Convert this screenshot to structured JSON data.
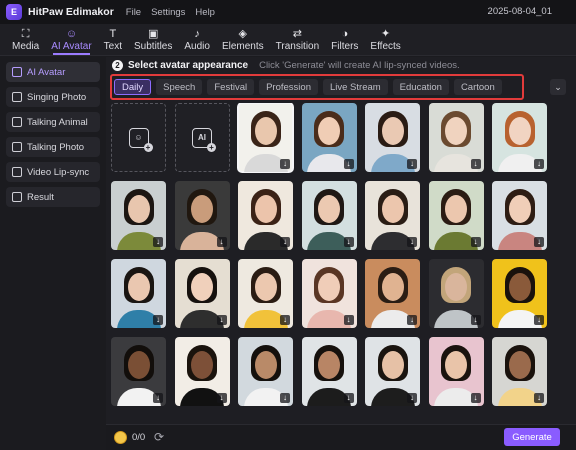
{
  "app": {
    "name": "HitPaw Edimakor",
    "logo_letter": "E",
    "project": "2025-08-04_01"
  },
  "menu": [
    "File",
    "Settings",
    "Help"
  ],
  "toolbar": [
    {
      "label": "Media",
      "icon": "media-icon",
      "glyph": "⛶"
    },
    {
      "label": "AI Avatar",
      "icon": "ai-avatar-icon",
      "glyph": "☺"
    },
    {
      "label": "Text",
      "icon": "text-icon",
      "glyph": "T"
    },
    {
      "label": "Subtitles",
      "icon": "subtitles-icon",
      "glyph": "▣"
    },
    {
      "label": "Audio",
      "icon": "audio-icon",
      "glyph": "♪"
    },
    {
      "label": "Elements",
      "icon": "elements-icon",
      "glyph": "◈"
    },
    {
      "label": "Transition",
      "icon": "transition-icon",
      "glyph": "⇄"
    },
    {
      "label": "Filters",
      "icon": "filters-icon",
      "glyph": "◑"
    },
    {
      "label": "Effects",
      "icon": "effects-icon",
      "glyph": "✦"
    }
  ],
  "sidebar": [
    {
      "label": "AI Avatar",
      "active": true
    },
    {
      "label": "Singing Photo"
    },
    {
      "label": "Talking Animal"
    },
    {
      "label": "Talking Photo"
    },
    {
      "label": "Video Lip-sync"
    },
    {
      "label": "Result"
    }
  ],
  "step": {
    "number": "2",
    "title": "Select avatar appearance",
    "hint": "Click 'Generate' will create AI lip-synced videos."
  },
  "tabs": [
    "Daily",
    "Speech",
    "Festival",
    "Profession",
    "Live Stream",
    "Education",
    "Cartoon"
  ],
  "active_tab": "Daily",
  "upload_tiles": [
    {
      "name": "upload-photo-tile",
      "glyph": "☺"
    },
    {
      "name": "ai-generate-tile",
      "glyph": "AI"
    }
  ],
  "download_glyph": "↓",
  "expand_glyph": "⌄",
  "avatars": [
    {
      "bg": "#f2f1ec",
      "skin": "#e9c7ad",
      "hair": "#3a2418",
      "cloth": "#d9d9d9",
      "selected": true
    },
    {
      "bg": "#7aa6c2",
      "skin": "#f0cdb5",
      "hair": "#4a2c1a",
      "cloth": "#e8e8ec"
    },
    {
      "bg": "#d8dde3",
      "skin": "#eac9b3",
      "hair": "#2a1c14",
      "cloth": "#7fa9c9"
    },
    {
      "bg": "#d9dcd6",
      "skin": "#f0d3bf",
      "hair": "#6b4a30",
      "cloth": "#e7e4de"
    },
    {
      "bg": "#d6e4e0",
      "skin": "#f1d4c2",
      "hair": "#b8622f",
      "cloth": "#f0f0f0"
    },
    {
      "bg": "#c9cfd0",
      "skin": "#e8c6ae",
      "hair": "#1c1612",
      "cloth": "#7c8a3a"
    },
    {
      "bg": "#3a3a3a",
      "skin": "#c99c7b",
      "hair": "#20170f",
      "cloth": "#d9b39a"
    },
    {
      "bg": "#efe8de",
      "skin": "#ecc4ab",
      "hair": "#3b2216",
      "cloth": "#2a2a2a"
    },
    {
      "bg": "#d3dfe0",
      "skin": "#ecc9b1",
      "hair": "#1f1814",
      "cloth": "#3d5e5a"
    },
    {
      "bg": "#e8e3da",
      "skin": "#ecc6ad",
      "hair": "#2a1d15",
      "cloth": "#2d2d30"
    },
    {
      "bg": "#d0dbc8",
      "skin": "#ecc7ae",
      "hair": "#2b1c13",
      "cloth": "#6b7a32"
    },
    {
      "bg": "#d9dfe4",
      "skin": "#f0ceb8",
      "hair": "#2e1d14",
      "cloth": "#c98580"
    },
    {
      "bg": "#cfd7df",
      "skin": "#eac7b0",
      "hair": "#1a1512",
      "cloth": "#2f7fa8"
    },
    {
      "bg": "#e5ded2",
      "skin": "#f0d0bb",
      "hair": "#16110e",
      "cloth": "#2e2e2e"
    },
    {
      "bg": "#eee9e0",
      "skin": "#ecc8af",
      "hair": "#2a1c13",
      "cloth": "#f1c23a"
    },
    {
      "bg": "#f0e3dd",
      "skin": "#f0cdb8",
      "hair": "#5a3624",
      "cloth": "#e8b7ae"
    },
    {
      "bg": "#c98c5e",
      "skin": "#e0b391",
      "hair": "#2a1d14",
      "cloth": "#ececec"
    },
    {
      "bg": "#2c2c30",
      "skin": "#d9b59c",
      "hair": "#c2a57a",
      "cloth": "#bfc4c7"
    },
    {
      "bg": "#f0c21b",
      "skin": "#8a5a3a",
      "hair": "#1a120c",
      "cloth": "#f4f4f4"
    },
    {
      "bg": "#3b3b3e",
      "skin": "#7a4f35",
      "hair": "#120e0b",
      "cloth": "#f2f2f2"
    },
    {
      "bg": "#f2ede6",
      "skin": "#7d5038",
      "hair": "#1a130d",
      "cloth": "#111111"
    },
    {
      "bg": "#d2d9de",
      "skin": "#b98a68",
      "hair": "#14100c",
      "cloth": "#f2f2f2"
    },
    {
      "bg": "#e0e4e6",
      "skin": "#b88565",
      "hair": "#16110d",
      "cloth": "#1c1c1c"
    },
    {
      "bg": "#dfe3e6",
      "skin": "#e6c1a6",
      "hair": "#1a140f",
      "cloth": "#1d1d1d"
    },
    {
      "bg": "#e8c4cf",
      "skin": "#e9c4a9",
      "hair": "#1a130e",
      "cloth": "#ececec"
    },
    {
      "bg": "#d6d6d2",
      "skin": "#9a6a4c",
      "hair": "#1a120d",
      "cloth": "#f2d38a"
    }
  ],
  "bottom": {
    "credits": "0/0",
    "generate": "Generate"
  }
}
